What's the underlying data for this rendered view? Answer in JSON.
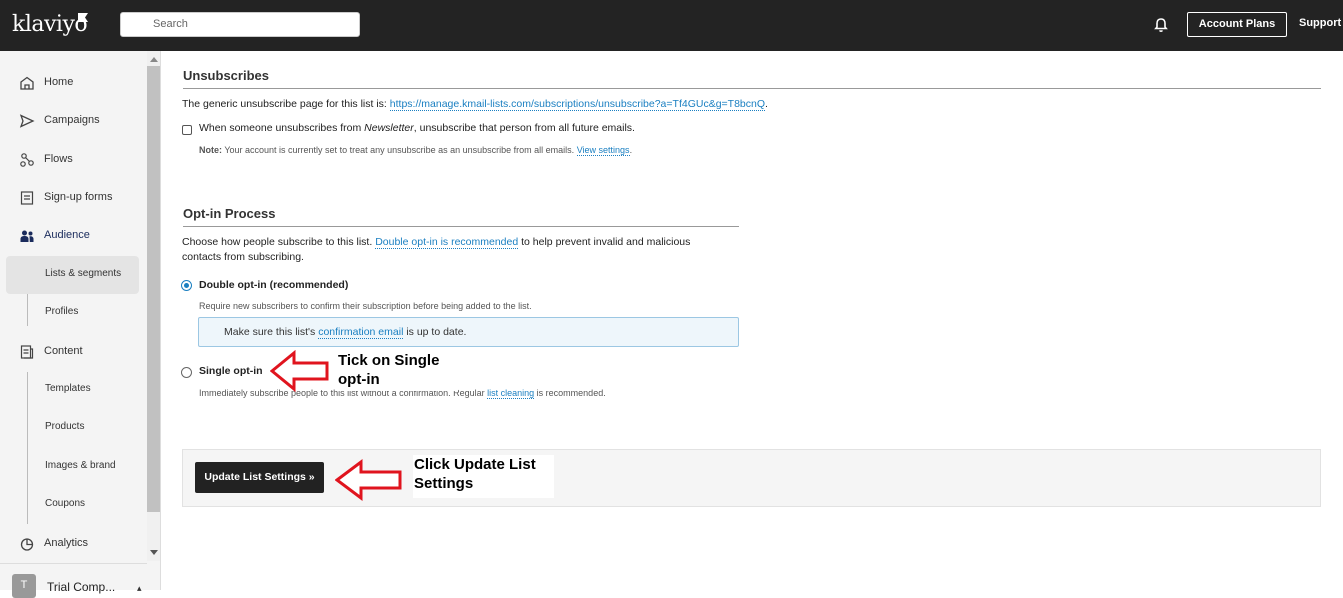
{
  "topbar": {
    "logo": "klaviyo",
    "search_placeholder": "Search",
    "account_plans": "Account Plans",
    "support": "Support"
  },
  "sidebar": {
    "home": "Home",
    "campaigns": "Campaigns",
    "flows": "Flows",
    "signup_forms": "Sign-up forms",
    "audience": "Audience",
    "lists_segments": "Lists & segments",
    "profiles": "Profiles",
    "content": "Content",
    "templates": "Templates",
    "products": "Products",
    "images_brand": "Images & brand",
    "coupons": "Coupons",
    "analytics": "Analytics",
    "account_initial": "T",
    "account_name": "Trial Comp..."
  },
  "unsubscribes": {
    "heading": "Unsubscribes",
    "page_text": "The generic unsubscribe page for this list is:",
    "page_url": "https://manage.kmail-lists.com/subscriptions/unsubscribe?a=Tf4GUc&g=T8bcnQ",
    "url_suffix": ".",
    "checkbox_pre": "When someone unsubscribes from ",
    "checkbox_list": "Newsletter",
    "checkbox_post": ", unsubscribe that person from all future emails.",
    "note_label": "Note:",
    "note_text": " Your account is currently set to treat any unsubscribe as an unsubscribe from all emails. ",
    "view_settings": "View settings",
    "note_suffix": "."
  },
  "optin": {
    "heading": "Opt-in Process",
    "intro_pre": "Choose how people subscribe to this list. ",
    "intro_link": "Double opt-in is recommended",
    "intro_post": " to help prevent invalid and malicious",
    "intro_line2": "contacts from subscribing.",
    "double_label": "Double opt-in (recommended)",
    "double_desc": "Require new subscribers to confirm their subscription before being added to the list.",
    "info_pre": "Make sure this list's ",
    "info_link": "confirmation email",
    "info_post": " is up to date.",
    "single_label": "Single opt-in",
    "single_desc": "Immediately subscribe people to this list without a confirmation. Regular ",
    "single_link": "list cleaning",
    "single_post": " is recommended."
  },
  "actions": {
    "update_button": "Update List Settings »"
  },
  "annotations": {
    "tick_line1": "Tick on Single",
    "tick_line2": "opt-in",
    "click_line1": "Click Update List",
    "click_line2": "Settings"
  },
  "colors": {
    "topbar_bg": "#232323",
    "link": "#1a7fc1",
    "annotation_arrow": "#e0141e"
  }
}
